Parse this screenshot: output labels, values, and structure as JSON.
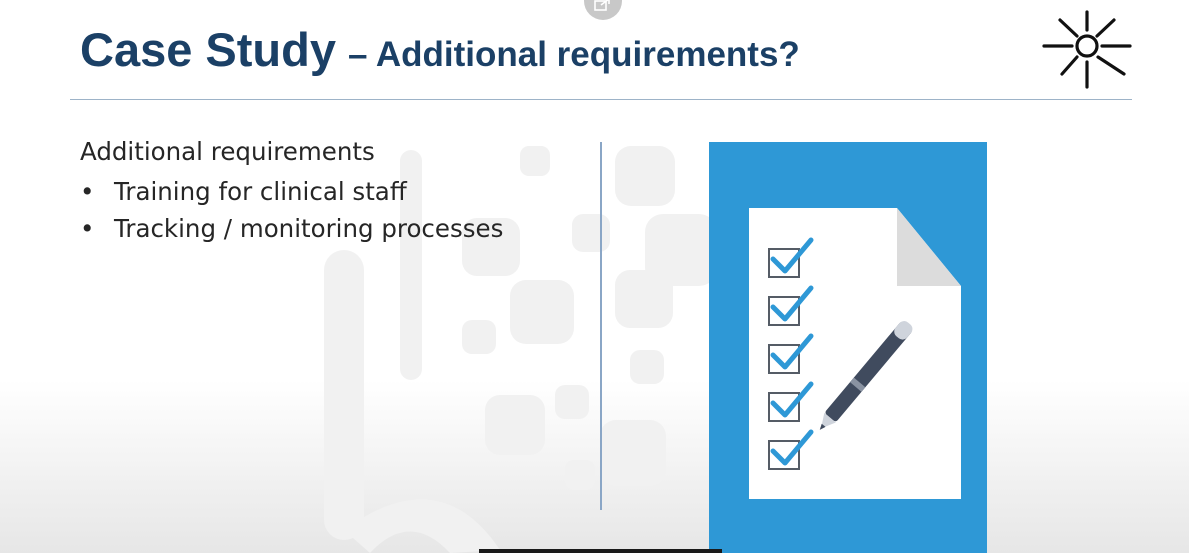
{
  "slide": {
    "title_main": "Case Study",
    "title_sub": "– Additional requirements?",
    "heading": "Additional requirements",
    "bullets": [
      "Training for clinical staff",
      "Tracking / monitoring processes"
    ],
    "bullet_glyph": "•"
  },
  "icons": {
    "popout": "popout-icon",
    "logo": "sun-logo-icon",
    "illustration": "checklist-with-pen-icon"
  },
  "colors": {
    "title": "#1b4066",
    "divider": "#8aa6c6",
    "illustration_bg": "#2e98d6",
    "checkmark": "#2e98d6",
    "pen": "#404b5e"
  }
}
